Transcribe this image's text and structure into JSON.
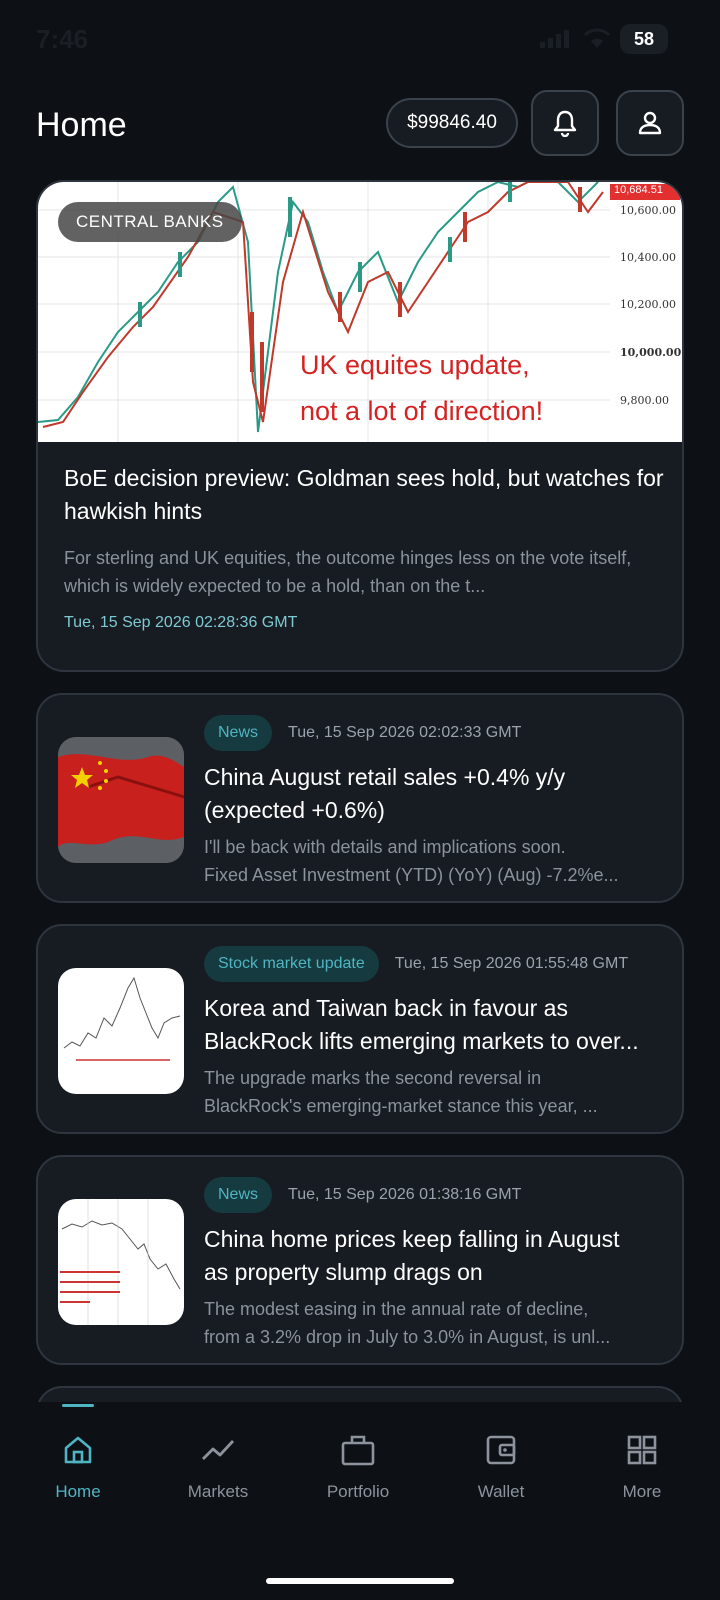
{
  "status": {
    "time": "7:46",
    "battery": "58"
  },
  "header": {
    "title": "Home",
    "balance": "$99846.40"
  },
  "featured": {
    "tag": "CENTRAL BANKS",
    "image_text_line1": "UK equites update,",
    "image_text_line2": "not a lot of direction!",
    "price_labels": [
      "10,684.51",
      "10,600.00",
      "10,400.00",
      "10,200.00",
      "10,000.00",
      "9,800.00"
    ],
    "title": "BoE decision preview: Goldman sees hold, but watches for hawkish hints",
    "summary": "For sterling and UK equities, the outcome hinges less on the vote itself, which is widely expected to be a hold, than on the t...",
    "date": "Tue, 15 Sep 2026 02:28:36 GMT"
  },
  "articles": [
    {
      "category": "News",
      "date": "Tue, 15 Sep 2026 02:02:33 GMT",
      "title_l1": "China August retail sales +0.4% y/y",
      "title_l2": "(expected +0.6%)",
      "summary_l1": "I'll be back with details and implications soon.",
      "summary_l2": "Fixed Asset Investment (YTD) (YoY) (Aug) -7.2%e..."
    },
    {
      "category": "Stock market update",
      "date": "Tue, 15 Sep 2026 01:55:48 GMT",
      "title_l1": "Korea and Taiwan back in favour as",
      "title_l2": "BlackRock lifts emerging markets to over...",
      "summary_l1": "The upgrade marks the second reversal in",
      "summary_l2": "BlackRock's emerging-market stance this year, ..."
    },
    {
      "category": "News",
      "date": "Tue, 15 Sep 2026 01:38:16 GMT",
      "title_l1": "China home prices keep falling in August",
      "title_l2": "as property slump drags on",
      "summary_l1": "The modest easing in the annual rate of decline,",
      "summary_l2": "from a 3.2% drop in July to 3.0% in August, is unl..."
    }
  ],
  "nav": [
    {
      "label": "Home",
      "icon": "home-icon",
      "active": true
    },
    {
      "label": "Markets",
      "icon": "markets-icon"
    },
    {
      "label": "Portfolio",
      "icon": "briefcase-icon"
    },
    {
      "label": "Wallet",
      "icon": "wallet-icon"
    },
    {
      "label": "More",
      "icon": "grid-icon"
    }
  ],
  "colors": {
    "accent": "#4fb5c2",
    "background": "#0d1116",
    "card": "#171c22",
    "overlay_red": "#d52222"
  }
}
